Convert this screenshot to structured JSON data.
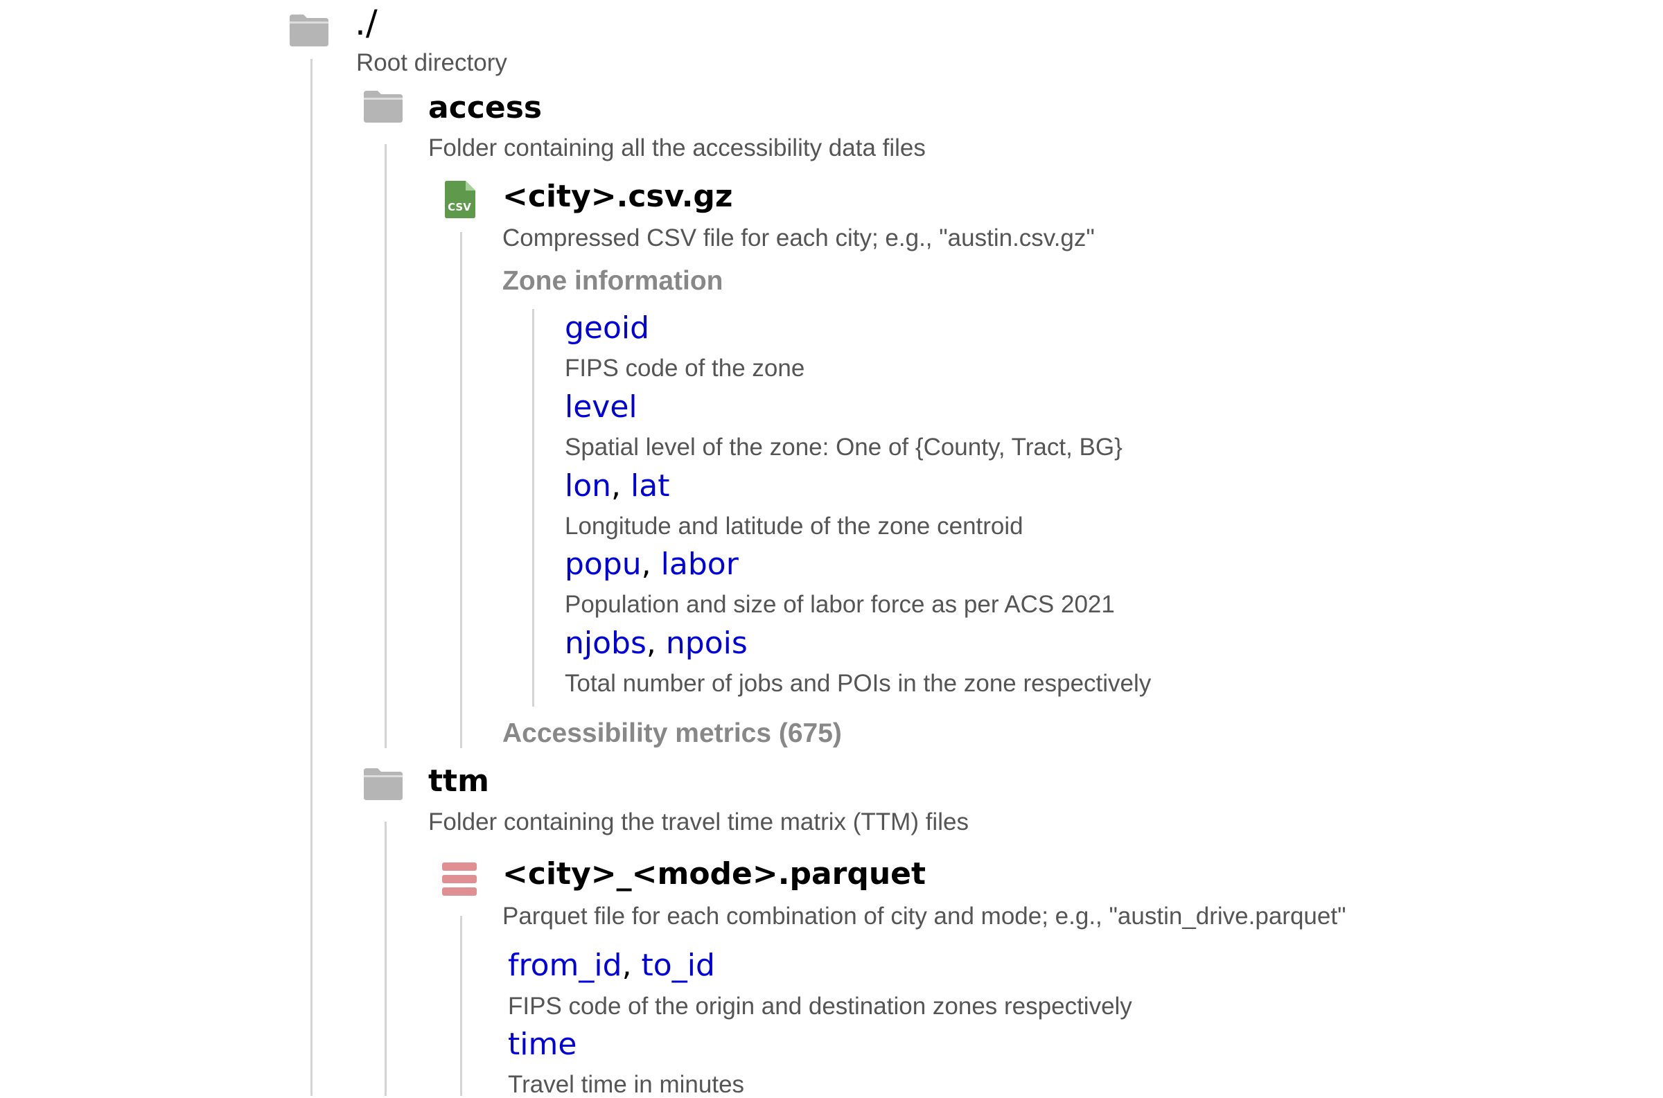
{
  "root": {
    "name": "./",
    "description": "Root directory"
  },
  "access": {
    "name": "access",
    "description": "Folder containing all the accessibility data files",
    "file": {
      "icon": "csv-file-icon",
      "icon_text": "CSV",
      "name": "<city>.csv.gz",
      "description": "Compressed CSV file for each city; e.g., \"austin.csv.gz\"",
      "zone_section": "Zone information",
      "fields": [
        {
          "names": [
            "geoid"
          ],
          "description": "FIPS code of the zone"
        },
        {
          "names": [
            "level"
          ],
          "description": "Spatial level of the zone: One of {County, Tract, BG}"
        },
        {
          "names": [
            "lon",
            "lat"
          ],
          "description": "Longitude and latitude of the zone centroid"
        },
        {
          "names": [
            "popu",
            "labor"
          ],
          "description": "Population and size of labor force as per ACS 2021"
        },
        {
          "names": [
            "njobs",
            "npois"
          ],
          "description": "Total number of jobs and POIs in the zone respectively"
        }
      ],
      "metrics_section": "Accessibility metrics (675)"
    }
  },
  "ttm": {
    "name": "ttm",
    "description": "Folder containing the travel time matrix (TTM) files",
    "file": {
      "icon": "parquet-file-icon",
      "name": "<city>_<mode>.parquet",
      "description": "Parquet file for each combination of city and mode; e.g., \"austin_drive.parquet\"",
      "fields": [
        {
          "names": [
            "from_id",
            "to_id"
          ],
          "description": "FIPS code of the origin and destination zones respectively"
        },
        {
          "names": [
            "time"
          ],
          "description": "Travel time in minutes"
        }
      ]
    }
  },
  "separator": ", ",
  "colors": {
    "field": "#0000dd",
    "description": "#555555",
    "section": "#888888",
    "folder": "#b5b5b5",
    "csv": "#5f9a4c",
    "parquet": "#e08f92",
    "tree_line": "#d4d4d4"
  }
}
